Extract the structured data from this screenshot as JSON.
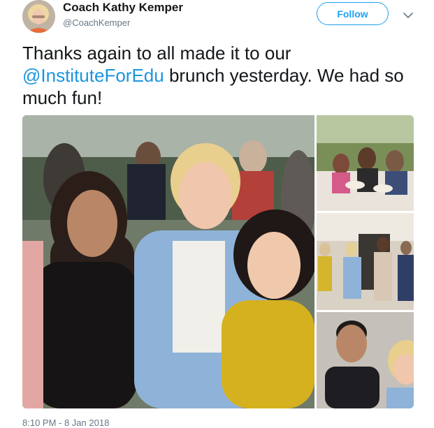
{
  "author": {
    "name": "Coach Kathy Kemper",
    "handle": "@CoachKemper"
  },
  "follow_label": "Follow",
  "tweet": {
    "text_before": "Thanks again to all made it to our ",
    "mention": "@InstituteForEdu",
    "text_after": " brunch yesterday. We had so much fun!"
  },
  "timestamp": "8:10 PM - 8 Jan 2018",
  "icons": {
    "menu": "chevron-down-icon",
    "avatar": "profile-photo"
  },
  "colors": {
    "accent": "#1da1f2",
    "mention": "#1b95e0",
    "secondary_text": "#657786"
  }
}
